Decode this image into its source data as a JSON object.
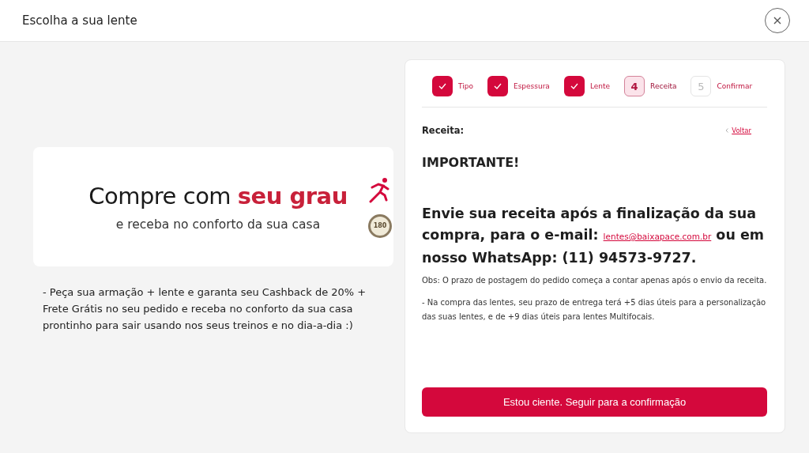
{
  "window": {
    "title": "Escolha a sua lente"
  },
  "banner": {
    "title": "Compre com",
    "title_highlight": "seu grau",
    "subtitle": "e receba no conforto da sua casa",
    "seal": "180"
  },
  "promo_text": "- Peça sua armação + lente e garanta seu Cashback de 20% + Frete Grátis no seu pedido e receba no conforto da sua casa prontinho para sair usando nos seus treinos e no dia-a-dia :)",
  "steps": [
    {
      "label": "Tipo",
      "completed": true,
      "selected": false
    },
    {
      "label": "Espessura",
      "completed": true,
      "selected": false
    },
    {
      "label": "Lente",
      "completed": true,
      "selected": false
    },
    {
      "number": "4",
      "label": "Receita",
      "completed": false,
      "selected": true
    },
    {
      "number": "5",
      "label": "Confirmar",
      "completed": false,
      "selected": false
    }
  ],
  "section_label": "Receita:",
  "back_link": "Voltar",
  "heading": "IMPORTANTE!",
  "message": {
    "before": "Envie sua receita após a finalização da sua compra, para o e-mail:",
    "email": "lentes@baixapace.com.br",
    "after": "ou em nosso WhatsApp: (11) 94573-9727."
  },
  "notes": [
    "Obs: O prazo de postagem do pedido começa a contar apenas após o envio da receita.",
    "- Na compra das lentes, seu prazo de entrega terá +5 dias úteis para a personalização das suas lentes, e de +9 dias úteis para lentes Multifocais."
  ],
  "confirm_button": "Estou ciente. Seguir para a confirmação"
}
